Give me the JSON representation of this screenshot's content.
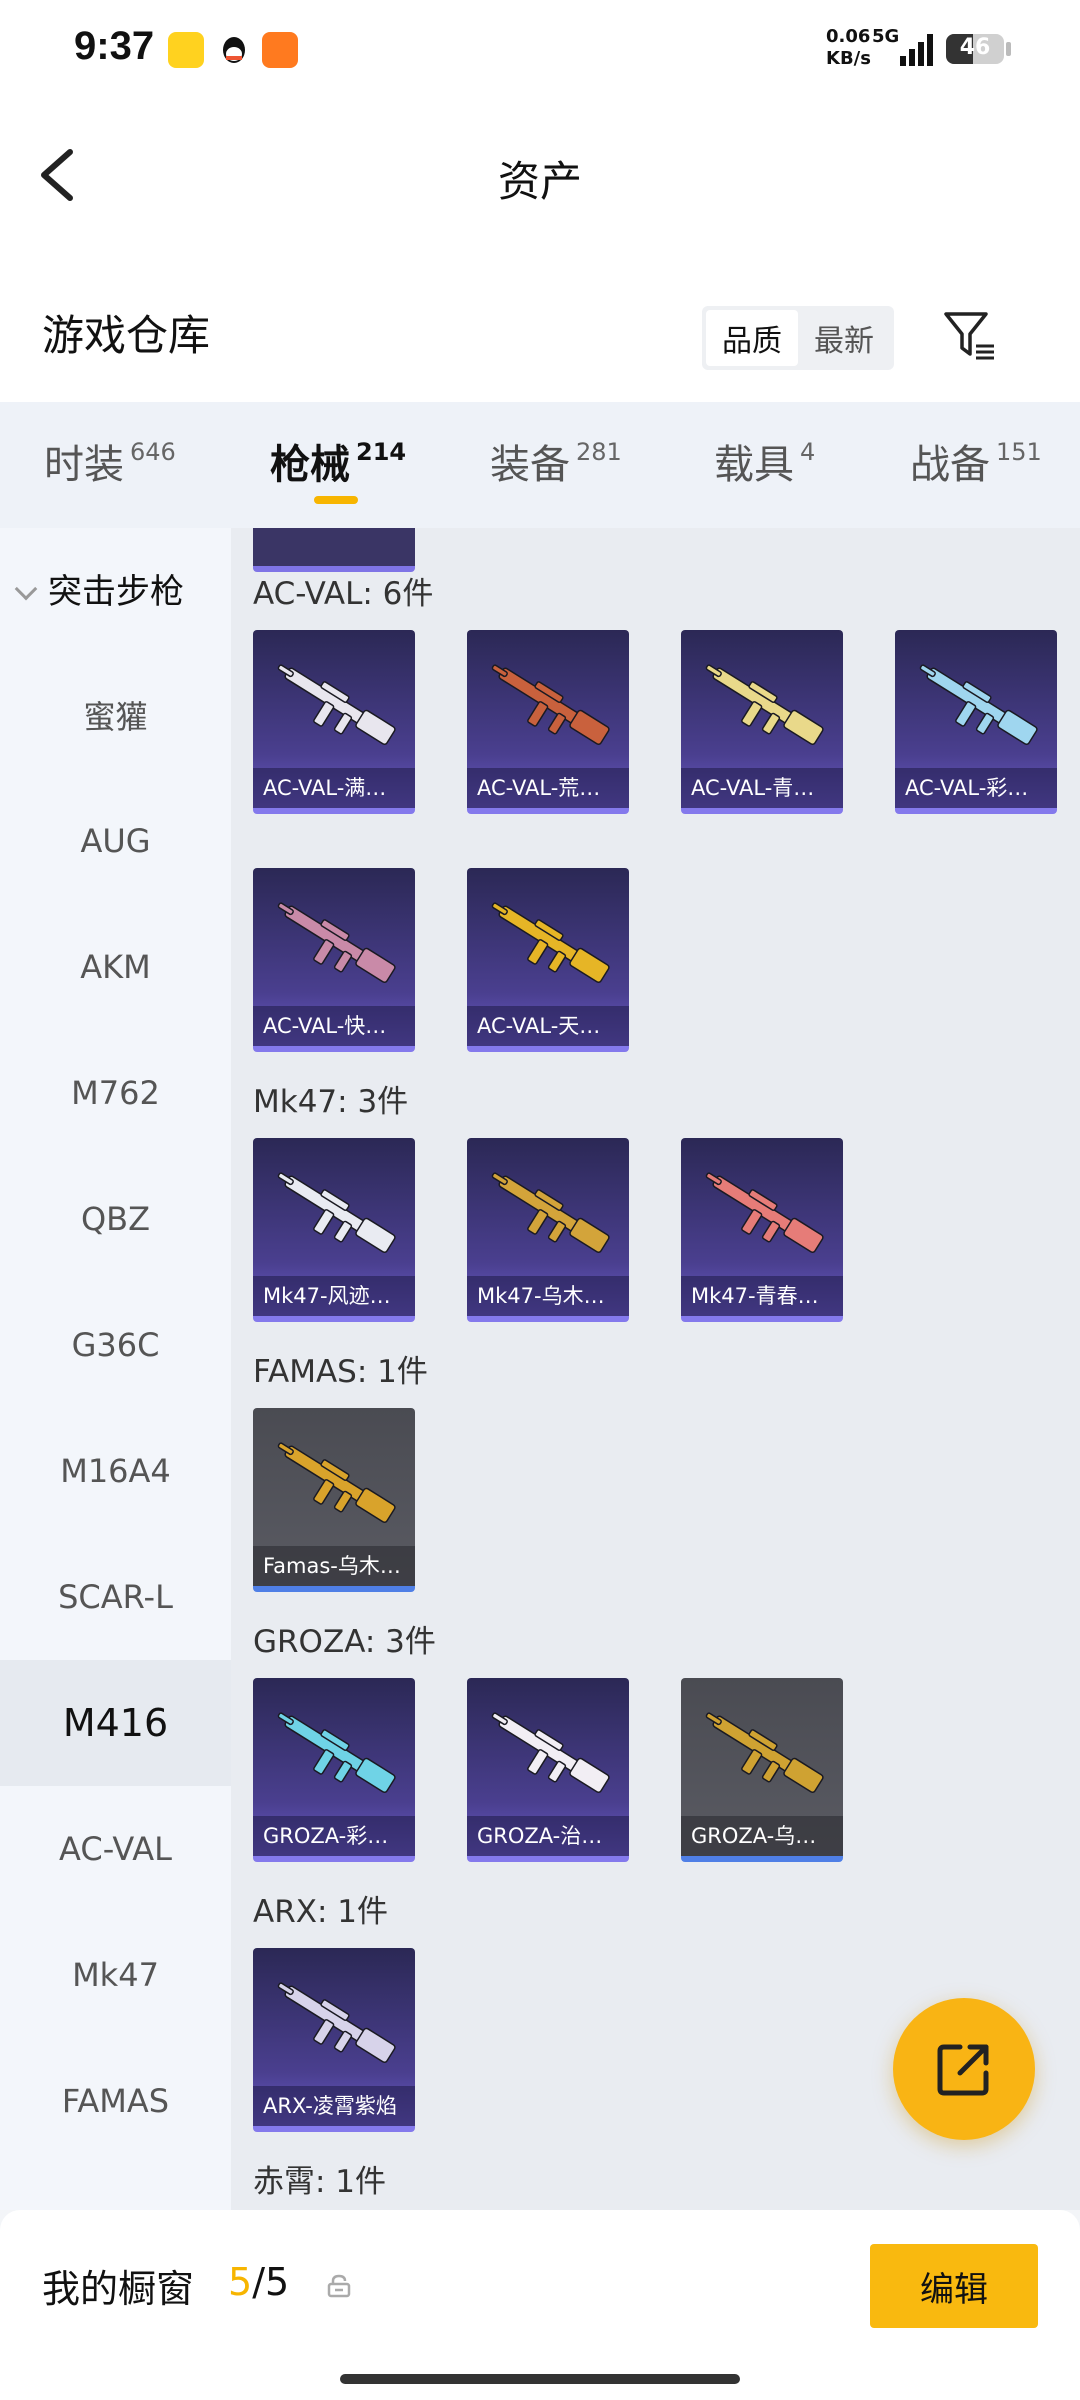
{
  "status_bar": {
    "time": "9:37",
    "net_speed_value": "0.06",
    "net_speed_unit": "KB/s",
    "network": "5G",
    "battery": "46"
  },
  "header": {
    "title": "资产"
  },
  "section": {
    "title": "游戏仓库",
    "sort_options": [
      "品质",
      "最新"
    ],
    "active_sort": "品质"
  },
  "tabs": [
    {
      "label": "时装",
      "count": "646"
    },
    {
      "label": "枪械",
      "count": "214",
      "active": true
    },
    {
      "label": "装备",
      "count": "281"
    },
    {
      "label": "载具",
      "count": "4"
    },
    {
      "label": "战备",
      "count": "151"
    }
  ],
  "sidebar": {
    "group": "突击步枪",
    "items": [
      "蜜獾",
      "AUG",
      "AKM",
      "M762",
      "QBZ",
      "G36C",
      "M16A4",
      "SCAR-L",
      "M416",
      "AC-VAL",
      "Mk47",
      "FAMAS"
    ],
    "active": "M416"
  },
  "groups": [
    {
      "label": "AC-VAL: 6件",
      "items": [
        "AC-VAL-满…",
        "AC-VAL-荒…",
        "AC-VAL-青…",
        "AC-VAL-彩…",
        "AC-VAL-快…",
        "AC-VAL-天…"
      ]
    },
    {
      "label": "Mk47: 3件",
      "items": [
        "Mk47-风迹…",
        "Mk47-乌木…",
        "Mk47-青春…"
      ]
    },
    {
      "label": "FAMAS: 1件",
      "items": [
        "Famas-乌木…"
      ]
    },
    {
      "label": "GROZA: 3件",
      "items": [
        "GROZA-彩…",
        "GROZA-治…",
        "GROZA-乌…"
      ]
    },
    {
      "label": "ARX: 1件",
      "items": [
        "ARX-凌霄紫焰"
      ]
    },
    {
      "label": "赤霄: 1件",
      "items": []
    }
  ],
  "weapon_colors": {
    "ac1": "#e8e6ee",
    "ac2": "#c9613d",
    "ac3": "#e9d98a",
    "ac4": "#9fd6ef",
    "ac5": "#c98aa8",
    "ac6": "#e6b526",
    "mk1": "#e9ebf2",
    "mk2": "#d3a43a",
    "mk3": "#e67c78",
    "fa1": "#d9a32b",
    "gr1": "#6fd3e6",
    "gr2": "#f2eef4",
    "gr3": "#cfa232",
    "arx1": "#d7d3ea"
  },
  "bottom": {
    "window_label": "我的橱窗",
    "current": "5",
    "total": "/5",
    "edit_label": "编辑"
  }
}
